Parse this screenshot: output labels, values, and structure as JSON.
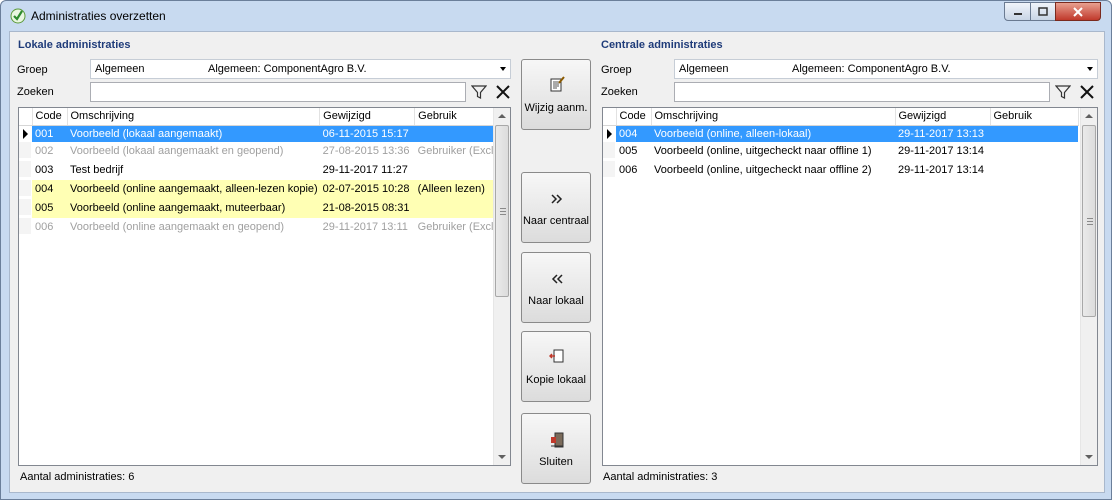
{
  "window": {
    "title": "Administraties overzetten"
  },
  "left": {
    "title": "Lokale administraties",
    "groep_label": "Groep",
    "groep_value": "Algemeen",
    "groep_desc": "Algemeen: ComponentAgro B.V.",
    "zoeken_label": "Zoeken",
    "zoeken_value": "",
    "columns": [
      "Code",
      "Omschrijving",
      "Gewijzigd",
      "Gebruik"
    ],
    "rows": [
      {
        "code": "001",
        "omschrijving": "Voorbeeld (lokaal aangemaakt)",
        "gewijzigd": "06-11-2015 15:17",
        "gebruik": "",
        "state": "selected"
      },
      {
        "code": "002",
        "omschrijving": "Voorbeeld (lokaal aangemaakt en geopend)",
        "gewijzigd": "27-08-2015 13:36",
        "gebruik": "Gebruiker (Excl.)",
        "state": "disabled"
      },
      {
        "code": "003",
        "omschrijving": "Test bedrijf",
        "gewijzigd": "29-11-2017 11:27",
        "gebruik": "",
        "state": "normal"
      },
      {
        "code": "004",
        "omschrijving": "Voorbeeld (online aangemaakt, alleen-lezen kopie)",
        "gewijzigd": "02-07-2015 10:28",
        "gebruik": "(Alleen lezen)",
        "state": "highlight"
      },
      {
        "code": "005",
        "omschrijving": "Voorbeeld (online aangemaakt, muteerbaar)",
        "gewijzigd": "21-08-2015 08:31",
        "gebruik": "",
        "state": "highlight"
      },
      {
        "code": "006",
        "omschrijving": "Voorbeeld (online aangemaakt en geopend)",
        "gewijzigd": "29-11-2017 13:11",
        "gebruik": "Gebruiker (Excl.)",
        "state": "disabled"
      }
    ],
    "status": "Aantal administraties: 6"
  },
  "right": {
    "title": "Centrale administraties",
    "groep_label": "Groep",
    "groep_value": "Algemeen",
    "groep_desc": "Algemeen: ComponentAgro B.V.",
    "zoeken_label": "Zoeken",
    "zoeken_value": "",
    "columns": [
      "Code",
      "Omschrijving",
      "Gewijzigd",
      "Gebruik"
    ],
    "rows": [
      {
        "code": "004",
        "omschrijving": "Voorbeeld (online, alleen-lokaal)",
        "gewijzigd": "29-11-2017 13:13",
        "gebruik": "",
        "state": "selected"
      },
      {
        "code": "005",
        "omschrijving": "Voorbeeld (online, uitgecheckt naar offline 1)",
        "gewijzigd": "29-11-2017 13:14",
        "gebruik": "",
        "state": "normal"
      },
      {
        "code": "006",
        "omschrijving": "Voorbeeld (online, uitgecheckt naar offline 2)",
        "gewijzigd": "29-11-2017 13:14",
        "gebruik": "",
        "state": "normal"
      }
    ],
    "status": "Aantal administraties: 3"
  },
  "buttons": {
    "wijzig": "Wijzig aanm.",
    "naar_centraal": "Naar centraal",
    "naar_lokaal": "Naar lokaal",
    "kopie_lokaal": "Kopie lokaal",
    "sluiten": "Sluiten"
  },
  "icons": {
    "app": "checkmark-shield-icon",
    "filter": "filter-icon",
    "clear": "close-x-icon",
    "wijzig": "edit-document-icon",
    "naar_centraal": "double-chevron-right-icon",
    "naar_lokaal": "double-chevron-left-icon",
    "kopie_lokaal": "copy-document-icon",
    "sluiten": "exit-door-icon"
  },
  "colors": {
    "selection": "#3399ff",
    "highlight_row": "#ffffb4",
    "section_title": "#1f3c7a",
    "disabled_text": "#a0a0a0"
  }
}
